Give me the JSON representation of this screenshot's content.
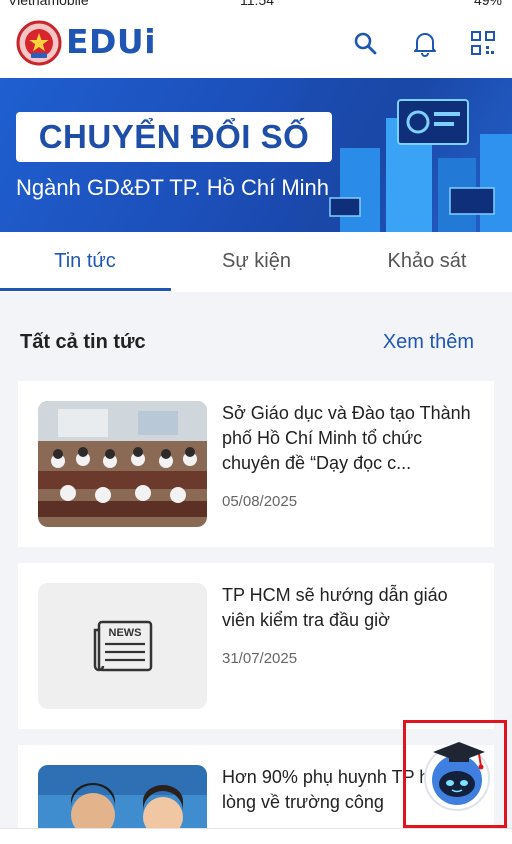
{
  "status_bar": {
    "carrier": "Vietnamobile",
    "time": "11:54",
    "battery": "49%"
  },
  "header": {
    "app_name": "EDUi"
  },
  "banner": {
    "title": "CHUYỂN ĐỔI SỐ",
    "subtitle": "Ngành GD&ĐT TP. Hồ Chí Minh"
  },
  "tabs": [
    {
      "label": "Tin tức",
      "active": true
    },
    {
      "label": "Sự kiện",
      "active": false
    },
    {
      "label": "Khảo sát",
      "active": false
    }
  ],
  "section": {
    "title": "Tất cả tin tức",
    "see_more": "Xem thêm"
  },
  "news": [
    {
      "title": "Sở Giáo dục và Đào tạo Thành phố Hồ Chí Minh tổ chức chuyên đề “Dạy đọc c...",
      "date": "05/08/2025",
      "thumbnail": "classroom-photo"
    },
    {
      "title": "TP HCM sẽ hướng dẫn giáo viên kiểm tra đầu giờ",
      "date": "31/07/2025",
      "thumbnail": "news-icon",
      "thumbnail_label": "NEWS"
    },
    {
      "title": "Hơn 90% phụ huynh TP hài lòng về trường công",
      "date": "",
      "thumbnail": "students-photo"
    }
  ],
  "icons": [
    "search-icon",
    "bell-icon",
    "qr-code-icon",
    "news-icon",
    "chatbot-icon"
  ],
  "colors": {
    "primary": "#1f56b3",
    "highlight_frame": "#e0141e",
    "background": "#f3f4f7"
  }
}
